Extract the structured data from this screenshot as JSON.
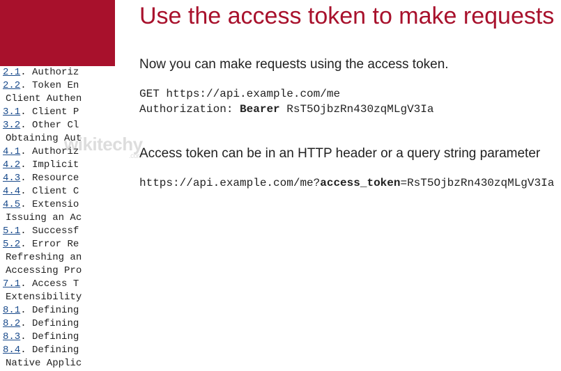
{
  "title": "Use the access token to make requests",
  "p1": "Now you can make requests using the access token.",
  "code1_line1": "GET https://api.example.com/me",
  "code1_line2_pre": "Authorization: ",
  "code1_line2_bold": "Bearer",
  "code1_line2_post": " RsT5OjbzRn430zqMLgV3Ia",
  "p2": "Access token can be in an HTTP header or a query string parameter",
  "code2_pre": "https://api.example.com/me?",
  "code2_bold": "access_token",
  "code2_post": "=RsT5OjbzRn430zqMLgV3Ia",
  "watermark": "wikitechy",
  "watermark_sub": ".com",
  "toc": [
    {
      "num": "2.1",
      "label": "Authoriz",
      "indent": false
    },
    {
      "num": "2.2",
      "label": "Token En",
      "indent": false
    },
    {
      "num": "",
      "label": "Client Authen",
      "indent": true
    },
    {
      "num": "3.1",
      "label": "Client P",
      "indent": false
    },
    {
      "num": "3.2",
      "label": "Other Cl",
      "indent": false
    },
    {
      "num": "",
      "label": "Obtaining Aut",
      "indent": true
    },
    {
      "num": "4.1",
      "label": "Authoriz",
      "indent": false
    },
    {
      "num": "4.2",
      "label": "Implicit",
      "indent": false
    },
    {
      "num": "4.3",
      "label": "Resource",
      "indent": false
    },
    {
      "num": "4.4",
      "label": "Client C",
      "indent": false
    },
    {
      "num": "4.5",
      "label": "Extensio",
      "indent": false
    },
    {
      "num": "",
      "label": "Issuing an Ac",
      "indent": true
    },
    {
      "num": "5.1",
      "label": "Successf",
      "indent": false
    },
    {
      "num": "5.2",
      "label": "Error Re",
      "indent": false
    },
    {
      "num": "",
      "label": "Refreshing an",
      "indent": true
    },
    {
      "num": "",
      "label": "Accessing Pro",
      "indent": true
    },
    {
      "num": "7.1",
      "label": "Access T",
      "indent": false
    },
    {
      "num": "",
      "label": "Extensibility",
      "indent": true
    },
    {
      "num": "8.1",
      "label": "Defining",
      "indent": false
    },
    {
      "num": "8.2",
      "label": "Defining",
      "indent": false
    },
    {
      "num": "8.3",
      "label": "Defining",
      "indent": false
    },
    {
      "num": "8.4",
      "label": "Defining",
      "indent": false
    },
    {
      "num": "",
      "label": "Native Applic",
      "indent": true
    }
  ]
}
